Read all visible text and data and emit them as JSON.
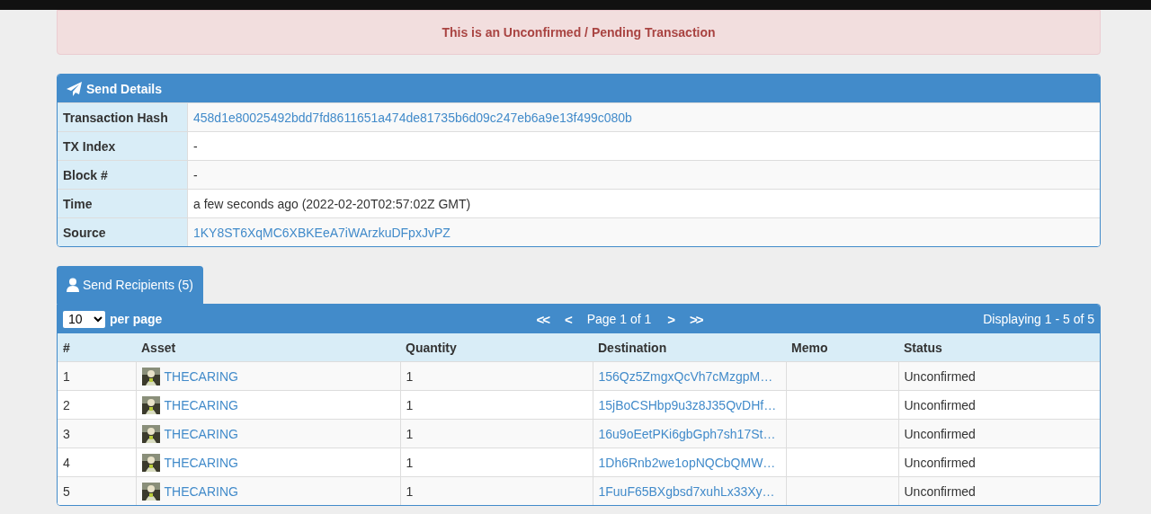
{
  "alert": {
    "text": "This is an Unconfirmed / Pending Transaction"
  },
  "details": {
    "title": "Send Details",
    "rows": [
      {
        "label": "Transaction Hash",
        "value": "458d1e80025492bdd7fd8611651a474de81735b6d09c247eb6a9e13f499c080b",
        "kind": "link"
      },
      {
        "label": "TX Index",
        "value": "-",
        "kind": "text"
      },
      {
        "label": "Block #",
        "value": "-",
        "kind": "text"
      },
      {
        "label": "Time",
        "value": "a few seconds ago (2022-02-20T02:57:02Z GMT)",
        "kind": "text"
      },
      {
        "label": "Source",
        "value": "1KY8ST6XqMC6XBKEeA7iWArzkuDFpxJvPZ",
        "kind": "link"
      }
    ]
  },
  "recipients": {
    "tab": {
      "label": "Send Recipients (5)",
      "selected": true
    },
    "per_page": {
      "value": "10",
      "label": "per page"
    },
    "pager": {
      "first": "<<",
      "prev": "<",
      "page": "Page 1 of 1",
      "next": ">",
      "last": ">>"
    },
    "displaying": "Displaying 1 - 5 of 5",
    "columns": [
      "#",
      "Asset",
      "Quantity",
      "Destination",
      "Memo",
      "Status"
    ],
    "rows": [
      {
        "index": "1",
        "asset": "THECARING",
        "quantity": "1",
        "destination": "156Qz5ZmgxQcVh7cMzgpM…",
        "status": "Unconfirmed"
      },
      {
        "index": "2",
        "asset": "THECARING",
        "quantity": "1",
        "destination": "15jBoCSHbp9u3z8J35QvDHf…",
        "status": "Unconfirmed"
      },
      {
        "index": "3",
        "asset": "THECARING",
        "quantity": "1",
        "destination": "16u9oEetPKi6gbGph7sh17St…",
        "status": "Unconfirmed"
      },
      {
        "index": "4",
        "asset": "THECARING",
        "quantity": "1",
        "destination": "1Dh6Rnb2we1opNQCbQMW…",
        "status": "Unconfirmed"
      },
      {
        "index": "5",
        "asset": "THECARING",
        "quantity": "1",
        "destination": "1FuuF65BXgbsd7xuhLx33Xy…",
        "status": "Unconfirmed"
      }
    ]
  }
}
